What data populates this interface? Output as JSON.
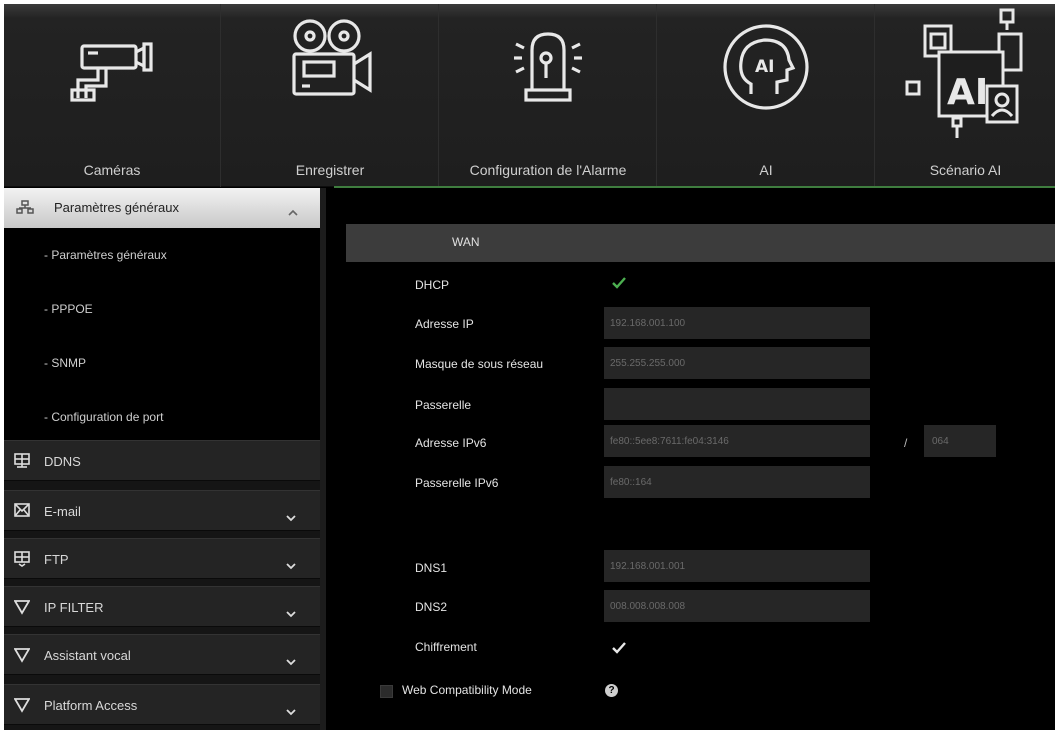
{
  "topbar": {
    "items": [
      {
        "label": "Caméras",
        "icon": "camera-icon"
      },
      {
        "label": "Enregistrer",
        "icon": "film-camera-icon"
      },
      {
        "label": "Configuration de l'Alarme",
        "icon": "alarm-light-icon"
      },
      {
        "label": "AI",
        "icon": "ai-head-icon"
      },
      {
        "label": "Scénario AI",
        "icon": "ai-scenario-icon"
      }
    ]
  },
  "sidebar": {
    "general": {
      "label": "Paramètres généraux",
      "icon": "network-icon"
    },
    "sub_items": [
      {
        "label": "- Paramètres généraux"
      },
      {
        "label": "- PPPOE"
      },
      {
        "label": "- SNMP"
      },
      {
        "label": "- Configuration de port"
      }
    ],
    "sections": [
      {
        "label": "DDNS",
        "icon": "ddns-icon",
        "chevron": false
      },
      {
        "label": "E-mail",
        "icon": "envelope-icon",
        "chevron": true
      },
      {
        "label": "FTP",
        "icon": "ftp-icon",
        "chevron": true
      },
      {
        "label": "IP FILTER",
        "icon": "filter-icon",
        "chevron": true
      },
      {
        "label": "Assistant vocal",
        "icon": "filter-icon",
        "chevron": true
      },
      {
        "label": "Platform Access",
        "icon": "filter-icon",
        "chevron": true
      }
    ]
  },
  "content": {
    "section_title": "WAN",
    "dhcp": {
      "label": "DHCP",
      "checked": true
    },
    "ip_address": {
      "label": "Adresse IP",
      "value": "192.168.001.100"
    },
    "subnet_mask": {
      "label": "Masque de sous réseau",
      "value": "255.255.255.000"
    },
    "gateway": {
      "label": "Passerelle",
      "value": ""
    },
    "ipv6_address": {
      "label": "Adresse IPv6",
      "value": "fe80::5ee8:7611:fe04:3146",
      "slash": "/",
      "prefix": "064"
    },
    "ipv6_gateway": {
      "label": "Passerelle IPv6",
      "value": "fe80::164"
    },
    "dns1": {
      "label": "DNS1",
      "value": "192.168.001.001"
    },
    "dns2": {
      "label": "DNS2",
      "value": "008.008.008.008"
    },
    "encryption": {
      "label": "Chiffrement",
      "checked": true
    },
    "web_compat": {
      "label": "Web Compatibility Mode",
      "checked": false,
      "help": "?"
    }
  },
  "colors": {
    "accent_green": "#4caf50",
    "panel": "#262626",
    "bar": "#3c3c3c"
  }
}
